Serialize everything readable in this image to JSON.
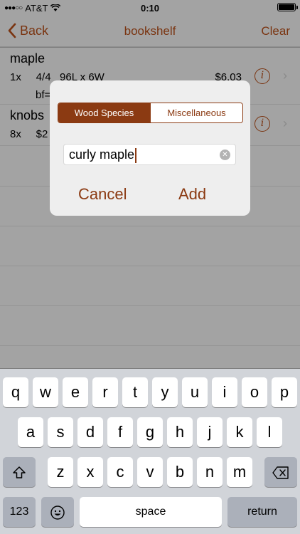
{
  "status_bar": {
    "carrier": "AT&T",
    "time": "0:10"
  },
  "nav": {
    "back_label": "Back",
    "title": "bookshelf",
    "clear_label": "Clear"
  },
  "list": {
    "rows": [
      {
        "name": "maple",
        "detail": "1x     4/4   96L x 6W",
        "price": "$6.03",
        "extra": "bf="
      },
      {
        "name": "knobs",
        "detail": "8x     $2"
      }
    ]
  },
  "alert": {
    "segments": [
      "Wood Species",
      "Miscellaneous"
    ],
    "selected_segment": "Wood Species",
    "input_value": "curly maple",
    "cancel_label": "Cancel",
    "add_label": "Add"
  },
  "keyboard": {
    "row1": [
      "q",
      "w",
      "e",
      "r",
      "t",
      "y",
      "u",
      "i",
      "o",
      "p"
    ],
    "row2": [
      "a",
      "s",
      "d",
      "f",
      "g",
      "h",
      "j",
      "k",
      "l"
    ],
    "row3": [
      "z",
      "x",
      "c",
      "v",
      "b",
      "n",
      "m"
    ],
    "numbers_label": "123",
    "space_label": "space",
    "return_label": "return"
  },
  "colors": {
    "accent": "#8b3a12",
    "dim_background": "#a3a3a3",
    "keyboard_bg": "#d1d4d9"
  }
}
